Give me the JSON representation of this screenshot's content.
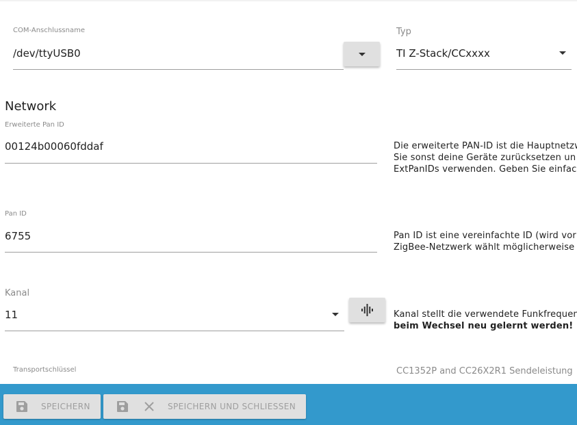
{
  "form": {
    "com_port": {
      "label": "COM-Anschlussname",
      "value": "/dev/ttyUSB0"
    },
    "type": {
      "label": "Typ",
      "value": "TI Z-Stack/CCxxxx"
    },
    "network_section_title": "Network",
    "ext_pan_id": {
      "label": "Erweiterte Pan ID",
      "value": "00124b00060fddaf",
      "help_lines": [
        "Die erweiterte PAN-ID ist die Hauptnetzw",
        "Sie sonst deine Geräte zurücksetzen un",
        "ExtPanIDs verwenden. Geben Sie einfach"
      ]
    },
    "pan_id": {
      "label": "Pan ID",
      "value": "6755",
      "help_lines": [
        "Pan ID ist eine vereinfachte ID (wird vor",
        "ZigBee-Netzwerk wählt möglicherweise"
      ]
    },
    "channel": {
      "label": "Kanal",
      "value": "11",
      "help_line_1": "Kanal stellt die verwendete Funkfrequen",
      "help_line_2_bold": "beim Wechsel neu gelernt werden!"
    },
    "transport_key": {
      "label": "Transportschlüssel"
    },
    "power": {
      "label": "CC1352P and CC26X2R1 Sendeleistung"
    }
  },
  "toolbar": {
    "save_label": "SPEICHERN",
    "save_close_label": "SPEICHERN UND SCHLIESSEN"
  },
  "icons": {
    "port_dropdown": "caret-down-icon",
    "type_dropdown": "caret-down-icon",
    "channel_dropdown": "caret-down-icon",
    "channel_scan": "waveform-icon",
    "save": "floppy-disk-icon",
    "close": "close-x-icon"
  },
  "colors": {
    "bottom_bar": "#3399cc",
    "button_bg": "#e0e0e0",
    "button_text_disabled": "#9e9e9e",
    "underline": "#9e9e9e"
  }
}
